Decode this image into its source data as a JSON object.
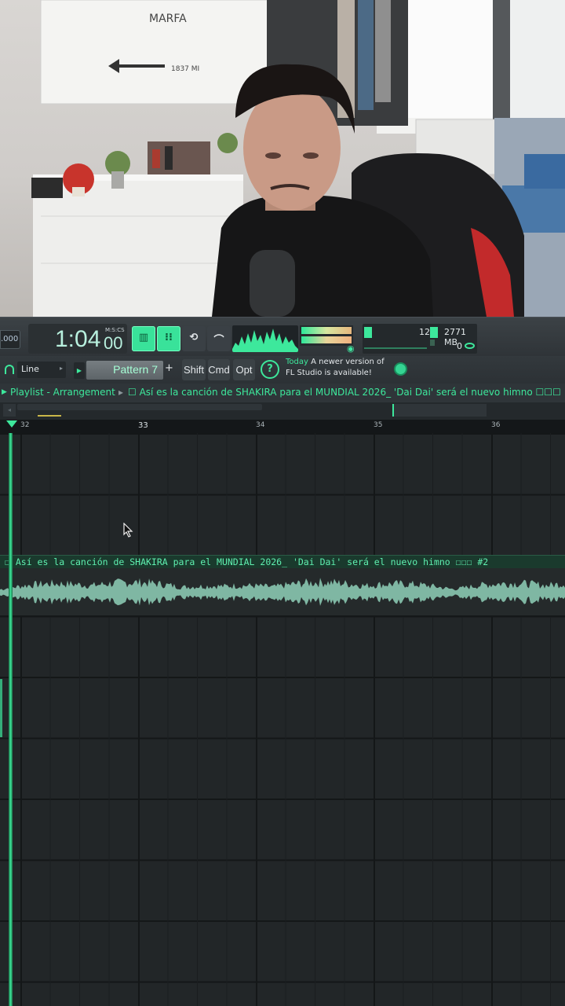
{
  "colors": {
    "accent": "#3de89c",
    "panel": "#2f3539",
    "grid": "#222628"
  },
  "webcam": {
    "sign_brand": "MARFA",
    "sign_text": "1837 MI"
  },
  "toolbar": {
    "tempo_value": ".000",
    "time_value": "1:04",
    "time_cs": "00",
    "time_mode": "M:S:CS",
    "buttons": [
      {
        "icon": "typing-keyboard-icon",
        "active": true
      },
      {
        "icon": "step-edit-icon",
        "active": true
      },
      {
        "icon": "loop-record-icon",
        "active": false
      },
      {
        "icon": "metronome-icon",
        "active": false
      }
    ],
    "cpu_polyphony": "12",
    "memory": "2771 MB",
    "voices": "0"
  },
  "toolbar2": {
    "snap_label": "Line",
    "pattern_label": "Pattern 7",
    "pattern_add": "+",
    "shift_label": "Shift",
    "cmd_label": "Cmd",
    "opt_label": "Opt",
    "news_day": "Today",
    "news_line1": "A newer version of",
    "news_line2": "FL Studio is available!"
  },
  "playlist": {
    "title": "Playlist - Arrangement",
    "separator": "▸",
    "track_title": "☐ Así es la canción de SHAKIRA para el MUNDIAL 2026_ 'Dai Dai' será el nuevo himno ☐☐☐",
    "ruler": [
      "32",
      "33",
      "34",
      "35",
      "36"
    ],
    "clip_name": "☐ Así es la canción de SHAKIRA para el MUNDIAL 2026_ 'Dai Dai' será el nuevo himno ☐☐☐ #2"
  }
}
